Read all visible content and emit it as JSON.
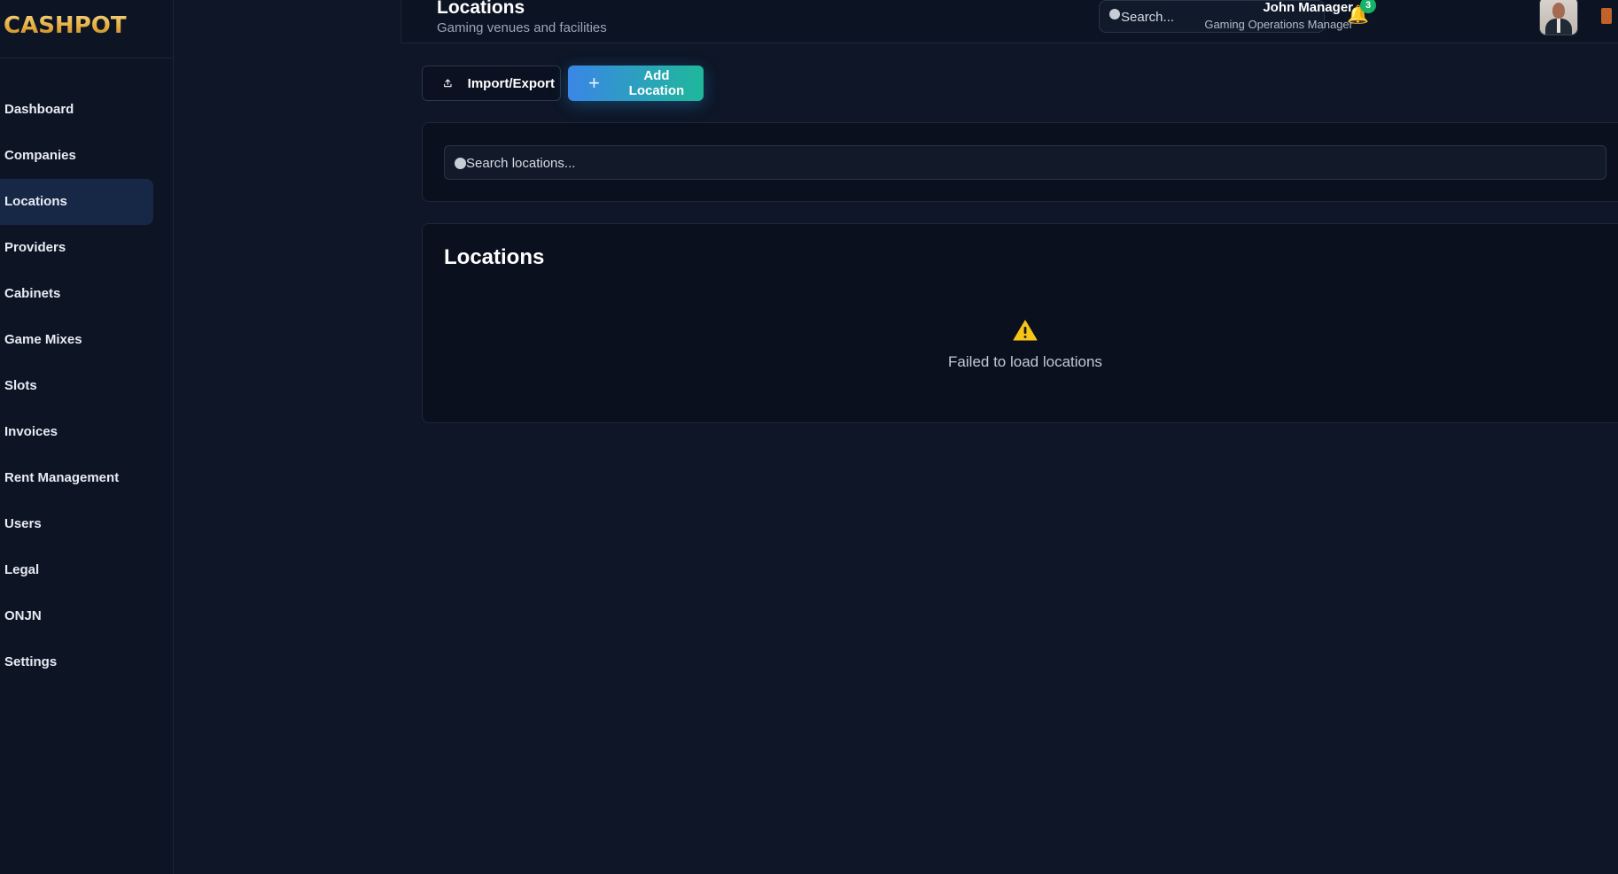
{
  "brand": {
    "logo_text": "CASHPOT"
  },
  "sidebar": {
    "items": [
      {
        "label": "Dashboard"
      },
      {
        "label": "Companies"
      },
      {
        "label": "Locations",
        "active": true
      },
      {
        "label": "Providers"
      },
      {
        "label": "Cabinets"
      },
      {
        "label": "Game Mixes"
      },
      {
        "label": "Slots"
      },
      {
        "label": "Invoices"
      },
      {
        "label": "Rent Management"
      },
      {
        "label": "Users"
      },
      {
        "label": "Legal"
      },
      {
        "label": "ONJN"
      },
      {
        "label": "Settings"
      }
    ]
  },
  "header": {
    "title": "Locations",
    "subtitle": "Gaming venues and facilities",
    "search_placeholder": "Search...",
    "notifications_count": "3",
    "user": {
      "name": "John Manager",
      "role": "Gaming Operations Manager"
    }
  },
  "toolbar": {
    "import_export_label": "Import/Export",
    "add_location_label": "Add Location"
  },
  "filters": {
    "search_placeholder": "Search locations..."
  },
  "locations_card": {
    "title": "Locations",
    "error_message": "Failed to load locations"
  },
  "colors": {
    "background": "#0e1627",
    "sidebar_active": "#172746",
    "accent_start": "#3a86e6",
    "accent_end": "#1fb89a",
    "warning": "#f5c518",
    "badge": "#17b26a"
  },
  "icons": {
    "search": "search-icon",
    "bell": "bell-icon",
    "upload": "upload-icon",
    "plus": "plus-icon",
    "warning": "warning-icon",
    "logout": "logout-icon"
  }
}
